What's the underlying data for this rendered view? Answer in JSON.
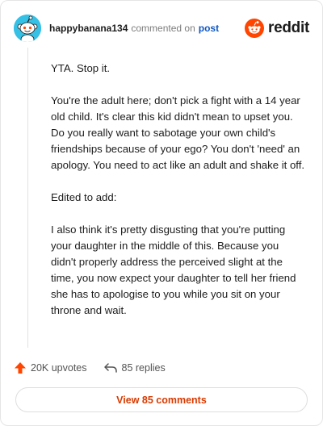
{
  "header": {
    "username": "happybanana134",
    "action_text": "commented on",
    "post_link": "post",
    "brand_name": "reddit"
  },
  "comment": {
    "paragraphs": [
      "YTA. Stop it.",
      "You're the adult here; don't pick a fight with a 14 year old child. It's clear this kid didn't mean to upset you. Do you really want to sabotage your own child's friendships because of your ego? You don't 'need' an apology. You need to act like an adult and shake it off.",
      "Edited to add:",
      "I also think it's pretty disgusting that you're putting your daughter in the middle of this. Because you didn't properly address the perceived slight at the time, you now expect your daughter to tell her friend she has to apologise to you while you sit on your throne and wait."
    ]
  },
  "stats": {
    "upvotes": "20K upvotes",
    "replies": "85 replies"
  },
  "view_button": "View 85 comments",
  "icons": {
    "avatar": "snoo-avatar-icon",
    "brand": "reddit-logo-icon",
    "upvote": "upvote-arrow-icon",
    "reply": "reply-arrow-icon"
  },
  "colors": {
    "brand_orange": "#ff4500",
    "upvote_orange": "#ff4500",
    "link_blue": "#0f57c2",
    "view_button_text": "#d93a00",
    "avatar_bg": "#35c0e6"
  }
}
